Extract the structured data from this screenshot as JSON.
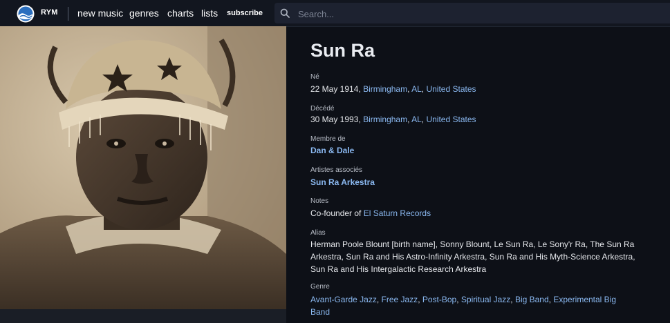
{
  "nav": {
    "brand": "RYM",
    "links": [
      "new music",
      "genres",
      "charts",
      "lists"
    ],
    "subscribe": "subscribe",
    "search_placeholder": "Search..."
  },
  "artist": {
    "name": "Sun Ra",
    "born": {
      "label": "Né",
      "date": "22 May 1914",
      "sep": ", ",
      "places": [
        "Birmingham",
        "AL",
        "United States"
      ]
    },
    "died": {
      "label": "Décédé",
      "date": "30 May 1993",
      "sep": ", ",
      "places": [
        "Birmingham",
        "AL",
        "United States"
      ]
    },
    "member_of": {
      "label": "Membre de",
      "value": "Dan & Dale"
    },
    "associated": {
      "label": "Artistes associés",
      "value": "Sun Ra Arkestra"
    },
    "notes": {
      "label": "Notes",
      "prefix": "Co-founder of ",
      "link": "El Saturn Records"
    },
    "aliases": {
      "label": "Alias",
      "text": "Herman Poole Blount [birth name], Sonny Blount, Le Sun Ra, Le Sony'r Ra, The Sun Ra Arkestra, Sun Ra and His Astro-Infinity Arkestra, Sun Ra and His Myth-Science Arkestra, Sun Ra and His Intergalactic Research Arkestra"
    },
    "genre": {
      "label": "Genre",
      "items": [
        "Avant-Garde Jazz",
        "Free Jazz",
        "Post-Bop",
        "Spiritual Jazz",
        "Big Band",
        "Experimental Big Band"
      ]
    }
  },
  "colors": {
    "background": "#0d1017",
    "nav": "#12161f",
    "link": "#8ab8f0",
    "photo_sepia": "#b9a68a"
  }
}
